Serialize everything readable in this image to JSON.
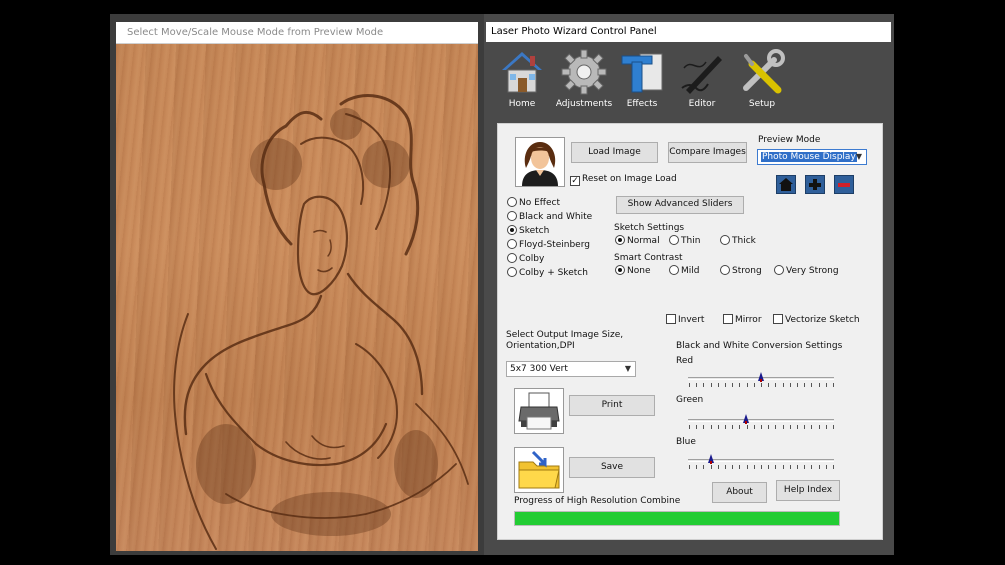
{
  "preview_window": {
    "title": "Select Move/Scale Mouse Mode from Preview Mode"
  },
  "control_window": {
    "title": "Laser Photo Wizard Control Panel"
  },
  "toolbar": [
    {
      "label": "Home",
      "icon": "home-icon"
    },
    {
      "label": "Adjustments",
      "icon": "gear-icon"
    },
    {
      "label": "Effects",
      "icon": "effects-icon"
    },
    {
      "label": "Editor",
      "icon": "pen-icon"
    },
    {
      "label": "Setup",
      "icon": "tools-icon"
    }
  ],
  "image_controls": {
    "load_image": "Load Image",
    "compare_images": "Compare Images",
    "reset_on_load": "Reset on Image Load",
    "reset_on_load_checked": true,
    "show_advanced": "Show Advanced Sliders"
  },
  "preview_mode": {
    "label": "Preview Mode",
    "value": "Photo Mouse Display"
  },
  "effects": {
    "options": [
      "No Effect",
      "Black and White",
      "Sketch",
      "Floyd-Steinberg",
      "Colby",
      "Colby + Sketch"
    ],
    "selected": "Sketch"
  },
  "sketch_settings": {
    "label": "Sketch Settings",
    "options": [
      "Normal",
      "Thin",
      "Thick"
    ],
    "selected": "Normal"
  },
  "smart_contrast": {
    "label": "Smart Contrast",
    "options": [
      "None",
      "Mild",
      "Strong",
      "Very Strong"
    ],
    "selected": "None"
  },
  "toggles": {
    "invert": "Invert",
    "mirror": "Mirror",
    "vectorize": "Vectorize Sketch"
  },
  "output": {
    "label_line1": "Select Output Image Size,",
    "label_line2": "Orientation,DPI",
    "value": "5x7 300 Vert"
  },
  "bw_conversion": {
    "title": "Black and White Conversion Settings",
    "red_label": "Red",
    "green_label": "Green",
    "blue_label": "Blue",
    "red_value": 0.5,
    "green_value": 0.4,
    "blue_value": 0.16
  },
  "actions": {
    "print": "Print",
    "save": "Save",
    "about": "About",
    "help": "Help Index"
  },
  "progress": {
    "label": "Progress of High Resolution Combine",
    "value": 1.0,
    "color": "#22cc33"
  }
}
